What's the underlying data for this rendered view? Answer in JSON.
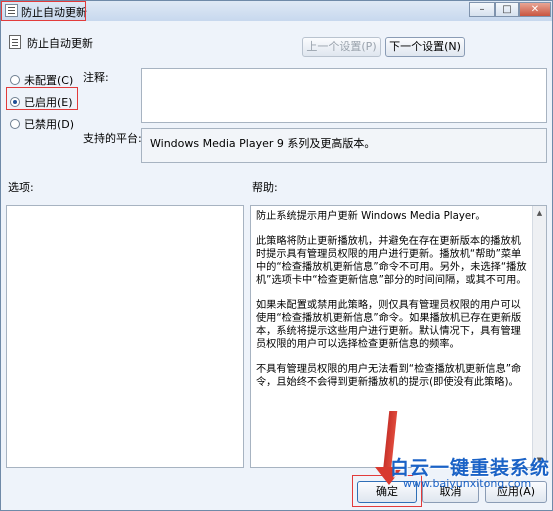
{
  "window": {
    "title": "防止自动更新",
    "controls": {
      "minimize": "–",
      "maximize": "□",
      "close": "✕"
    }
  },
  "header": {
    "setting_name": "防止自动更新",
    "prev_button": "上一个设置(P)",
    "next_button": "下一个设置(N)"
  },
  "state_options": [
    {
      "label": "未配置(C)",
      "checked": false
    },
    {
      "label": "已启用(E)",
      "checked": true
    },
    {
      "label": "已禁用(D)",
      "checked": false
    }
  ],
  "comment": {
    "label": "注释:",
    "value": ""
  },
  "platform": {
    "label": "支持的平台:",
    "value": "Windows Media Player 9 系列及更高版本。"
  },
  "options": {
    "label": "选项:"
  },
  "help": {
    "label": "帮助:",
    "paragraphs": [
      "防止系统提示用户更新 Windows Media Player。",
      "此策略将防止更新播放机，并避免在存在更新版本的播放机时提示具有管理员权限的用户进行更新。播放机“帮助”菜单中的“检查播放机更新信息”命令不可用。另外，未选择“播放机”选项卡中“检查更新信息”部分的时间间隔，或其不可用。",
      "如果未配置或禁用此策略，则仅具有管理员权限的用户可以使用“检查播放机更新信息”命令。如果播放机已存在更新版本，系统将提示这些用户进行更新。默认情况下，具有管理员权限的用户可以选择检查更新信息的频率。",
      "不具有管理员权限的用户无法看到“检查播放机更新信息”命令，且始终不会得到更新播放机的提示(即使没有此策略)。"
    ]
  },
  "footer": {
    "ok": "确定",
    "cancel": "取消",
    "apply": "应用(A)"
  },
  "watermark": {
    "brand": "白云一键重装系统",
    "url": "www.baiyunxitong.com"
  },
  "colors": {
    "highlight": "#e23b3b",
    "watermark": "#1a62c6"
  }
}
